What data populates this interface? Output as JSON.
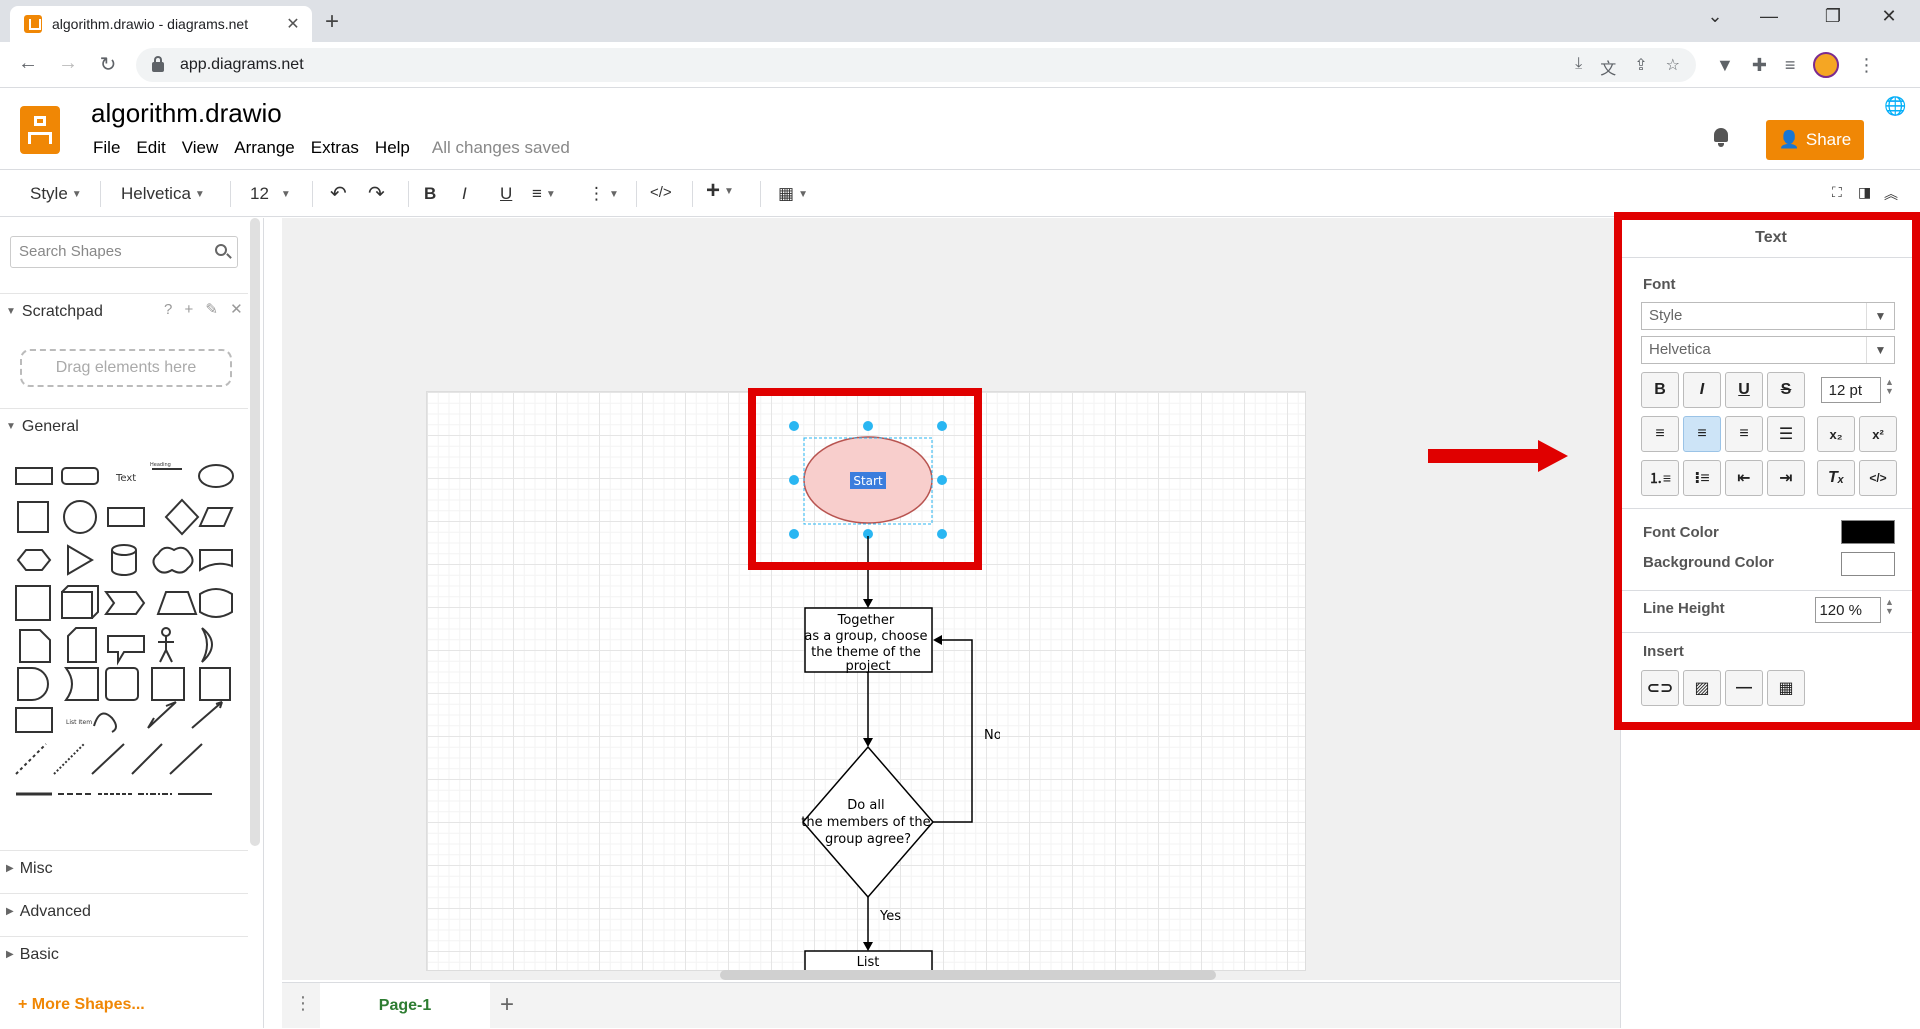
{
  "browser": {
    "tab_title": "algorithm.drawio - diagrams.net",
    "tab_close": "✕",
    "new_tab": "+",
    "url": "app.diagrams.net",
    "window_controls": [
      "⌄",
      "—",
      "❐",
      "✕"
    ]
  },
  "app": {
    "doc_title": "algorithm.drawio",
    "menu": [
      "File",
      "Edit",
      "View",
      "Arrange",
      "Extras",
      "Help"
    ],
    "save_status": "All changes saved",
    "share_label": "Share"
  },
  "toolbar": {
    "style_label": "Style",
    "font_label": "Helvetica",
    "size_label": "12",
    "bold": "B",
    "italic": "I",
    "underline": "U",
    "code": "</>",
    "insert": "+"
  },
  "sidebar": {
    "search_placeholder": "Search Shapes",
    "scratchpad_label": "Scratchpad",
    "scratchpad_tools": "? + ✎ ✕",
    "drag_hint": "Drag elements here",
    "sections": [
      "General",
      "Misc",
      "Advanced",
      "Basic"
    ],
    "more_shapes": "+ More Shapes...",
    "shape_text": "Text",
    "shape_heading": "Heading",
    "shape_list_item": "List Item"
  },
  "diagram": {
    "start_label": "Start",
    "step1_label": [
      "Together",
      "as a group, choose",
      "the theme of the",
      "project"
    ],
    "decision_label": [
      "Do all",
      "the members of the",
      "group agree?"
    ],
    "no_label": "No",
    "yes_label": "Yes",
    "next_label": "List",
    "start_fill": "#f8cecc",
    "start_stroke": "#b85450"
  },
  "bottom": {
    "page_tab": "Page-1",
    "add_page": "+",
    "page_menu": "⋮"
  },
  "format_panel": {
    "tab": "Text",
    "font_heading": "Font",
    "style_select": "Style",
    "font_select": "Helvetica",
    "font_size": "12 pt",
    "bold": "B",
    "italic": "I",
    "underline": "U",
    "strike": "S",
    "font_color_label": "Font Color",
    "font_color": "#000000",
    "bg_color_label": "Background Color",
    "bg_color": "#ffffff",
    "line_height_label": "Line Height",
    "line_height": "120 %",
    "insert_label": "Insert",
    "code_btn": "</>"
  },
  "annotation": {
    "highlight_color": "#e00000"
  }
}
